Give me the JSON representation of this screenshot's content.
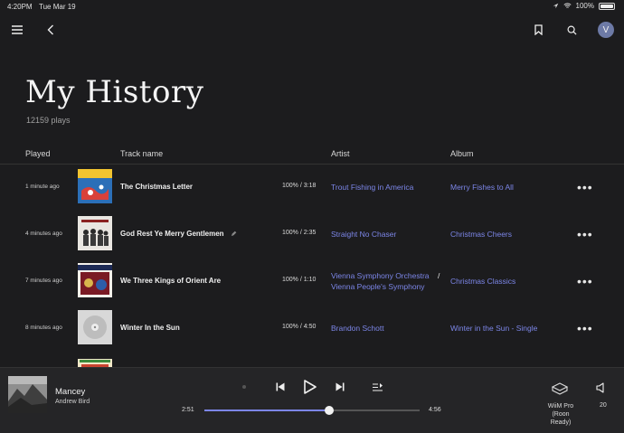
{
  "status_bar": {
    "time": "4:20PM",
    "date": "Tue Mar 19",
    "battery": "100%"
  },
  "header": {
    "avatar_letter": "V"
  },
  "page": {
    "title": "My History",
    "plays": "12159 plays"
  },
  "columns": {
    "played": "Played",
    "track": "Track name",
    "artist": "Artist",
    "album": "Album"
  },
  "rows": [
    {
      "played": "1 minute ago",
      "track": "The Christmas Letter",
      "duration": "100% / 3:18",
      "artist_1": "Trout Fishing in America",
      "artist_sep": "",
      "artist_2": "",
      "album": "Merry Fishes to All",
      "more": "•••"
    },
    {
      "played": "4 minutes ago",
      "track": "God Rest Ye Merry Gentlemen",
      "duration": "100% / 2:35",
      "artist_1": "Straight No Chaser",
      "artist_sep": "",
      "artist_2": "",
      "album": "Christmas Cheers",
      "more": "•••"
    },
    {
      "played": "7 minutes ago",
      "track": "We Three Kings of Orient Are",
      "duration": "100% / 1:10",
      "artist_1": "Vienna Symphony Orchestra",
      "artist_sep": "/",
      "artist_2": "Vienna People's Symphony",
      "album": "Christmas Classics",
      "more": "•••"
    },
    {
      "played": "8 minutes ago",
      "track": "Winter In the Sun",
      "duration": "100% / 4:50",
      "artist_1": "Brandon Schott",
      "artist_sep": "",
      "artist_2": "",
      "album": "Winter in the Sun - Single",
      "more": "•••"
    }
  ],
  "now_playing": {
    "title": "Mancey",
    "artist": "Andrew Bird",
    "elapsed": "2:51",
    "total": "4:56",
    "progress": 0.58,
    "zone_name": "WiiM Pro",
    "zone_sub": "(Roon Ready)",
    "volume": "20"
  },
  "colors": {
    "accent": "#7c86e8",
    "background": "#1c1c1e",
    "player_bg": "#252527"
  }
}
